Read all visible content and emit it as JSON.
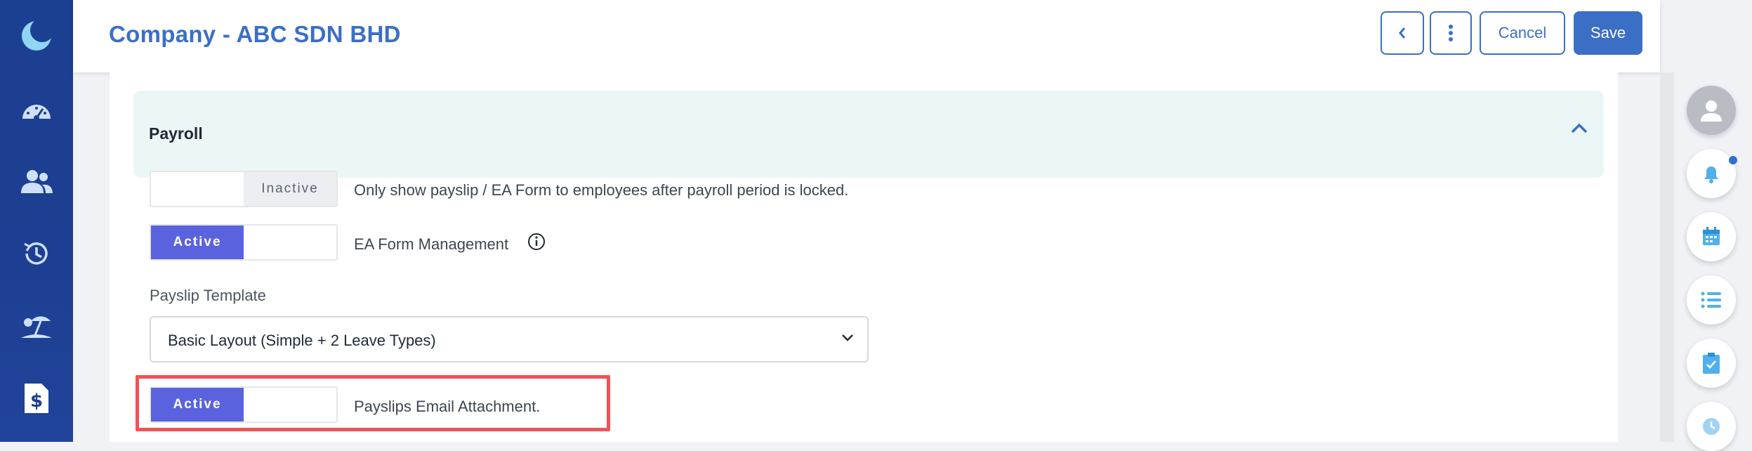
{
  "header": {
    "title": "Company - ABC SDN BHD",
    "buttons": {
      "back": "back",
      "more": "more",
      "cancel": "Cancel",
      "save": "Save"
    }
  },
  "nav": {
    "items": [
      "logo-icon",
      "dashboard-icon",
      "people-icon",
      "history-icon",
      "leave-icon",
      "payroll-icon"
    ],
    "accent": "#1d3f93"
  },
  "section": {
    "title": "Payroll"
  },
  "settings": [
    {
      "state": "Inactive",
      "label": "Only show payslip / EA Form to employees after payroll period is locked."
    },
    {
      "state": "Active",
      "label": "EA Form Management"
    }
  ],
  "payslip_template": {
    "label": "Payslip Template",
    "selected": "Basic Layout (Simple + 2 Leave Types)"
  },
  "email_attachment": {
    "state": "Active",
    "label": "Payslips Email Attachment."
  },
  "colors": {
    "primary": "#3b6fc6",
    "toggle_active": "#5a63dd",
    "highlight": "#ef5358",
    "section_bg": "#eaf7f6"
  }
}
